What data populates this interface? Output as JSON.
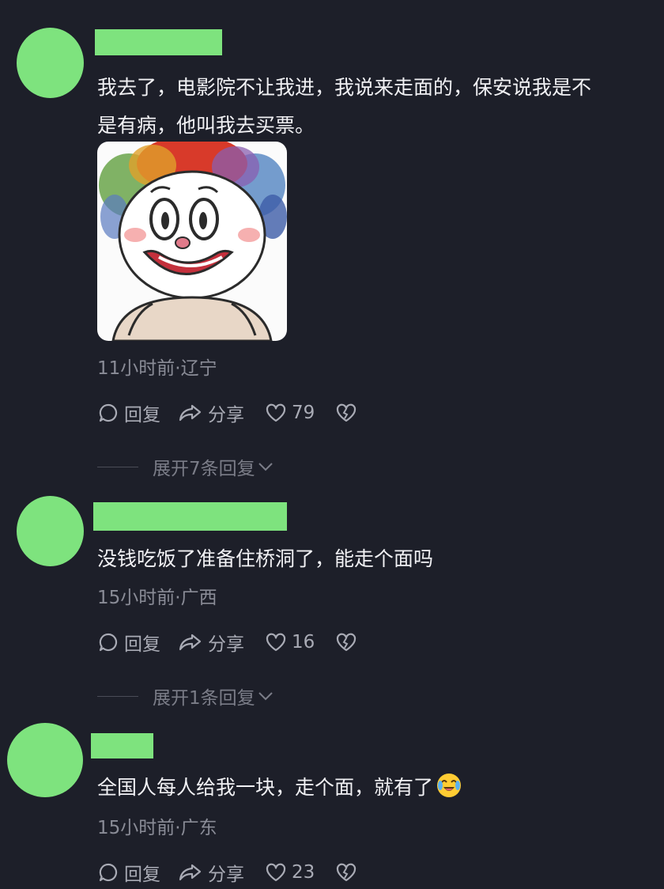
{
  "comments": [
    {
      "text": "我去了，电影院不让我进，我说来走面的，保安说我是不\n是有病，他叫我去买票。",
      "meta": "11小时前·辽宁",
      "reply_label": "回复",
      "share_label": "分享",
      "likes": "79",
      "expand_label": "展开7条回复"
    },
    {
      "text": "没钱吃饭了准备住桥洞了，能走个面吗",
      "meta": "15小时前·广西",
      "reply_label": "回复",
      "share_label": "分享",
      "likes": "16",
      "expand_label": "展开1条回复"
    },
    {
      "text": "全国人每人给我一块，走个面，就有了",
      "meta": "15小时前·广东",
      "reply_label": "回复",
      "share_label": "分享",
      "likes": "23"
    }
  ],
  "colors": {
    "background": "#1d1f29",
    "avatar_placeholder": "#7ee37e",
    "text": "#f1f1f4",
    "meta": "#8a8c97",
    "action": "#a9abb5"
  },
  "icons": {
    "reply": "speech-bubble-icon",
    "share": "share-arrow-icon",
    "like": "heart-icon",
    "dislike": "broken-heart-icon",
    "expand": "chevron-down-icon",
    "emoji": "crying-laughing-emoji-icon",
    "sticker": "clown-sticker"
  }
}
